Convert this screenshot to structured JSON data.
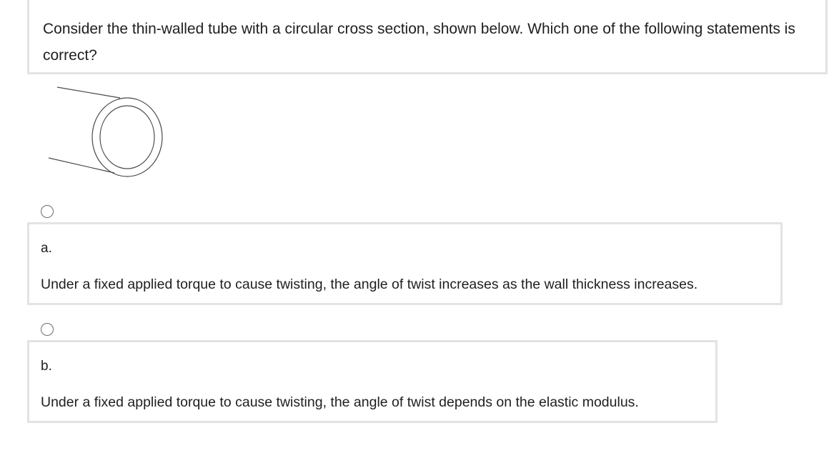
{
  "question": {
    "text": "Consider the thin-walled tube with a circular cross section, shown below. Which one of the following statements is correct?"
  },
  "figure": {
    "icon": "thin-walled-tube-icon",
    "stroke_color": "#4a4a4a"
  },
  "options": [
    {
      "letter": "a.",
      "text": "Under a fixed applied torque to cause twisting, the angle of twist increases as the wall thickness increases."
    },
    {
      "letter": "b.",
      "text": "Under a fixed applied torque to cause twisting, the angle of twist depends on the elastic modulus."
    }
  ],
  "colors": {
    "border": "#e3e3e3",
    "text": "#1f1f1f",
    "radio_border": "#6d6d6d"
  }
}
